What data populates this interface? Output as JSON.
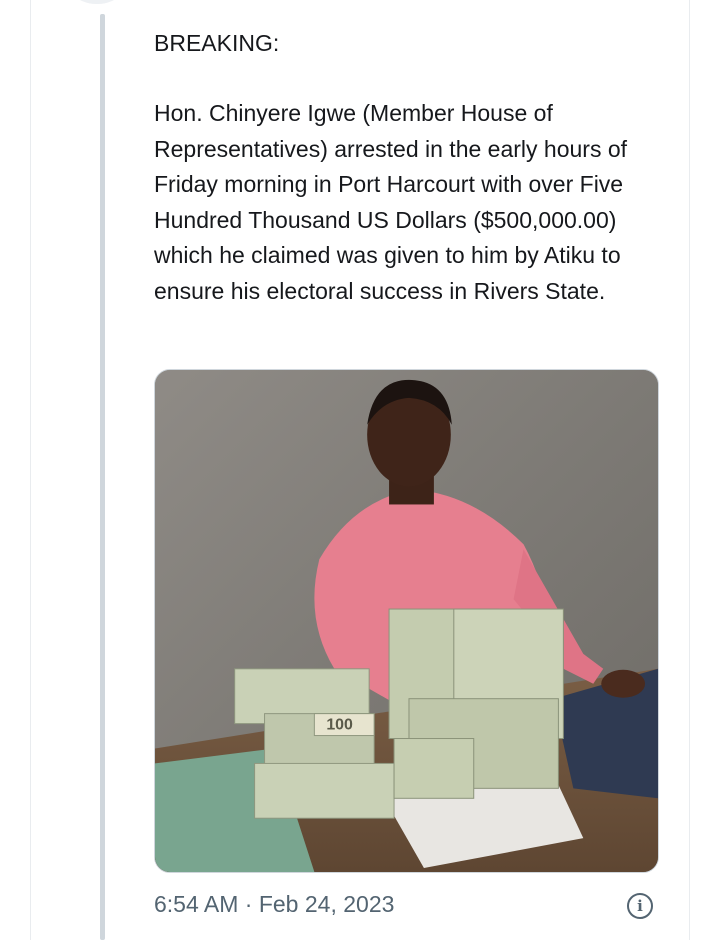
{
  "tweet": {
    "headline": "BREAKING:",
    "body": "Hon. Chinyere Igwe (Member House of Representatives) arrested in the early hours of Friday morning in Port Harcourt with over Five Hundred Thousand US Dollars ($500,000.00) which he claimed was given to him by Atiku to ensure his electoral success in Rivers State.",
    "time": "6:54 AM",
    "separator": "·",
    "date": "Feb 24, 2023"
  },
  "media": {
    "banknote_label": "100"
  },
  "icons": {
    "info": "info-circle-icon"
  },
  "colors": {
    "text": "#16181c",
    "meta": "#536471",
    "thread_line": "#cfd6dc",
    "shirt": "#e67f8f",
    "wall": "#8c8882",
    "cash": "#c9d1b6"
  }
}
